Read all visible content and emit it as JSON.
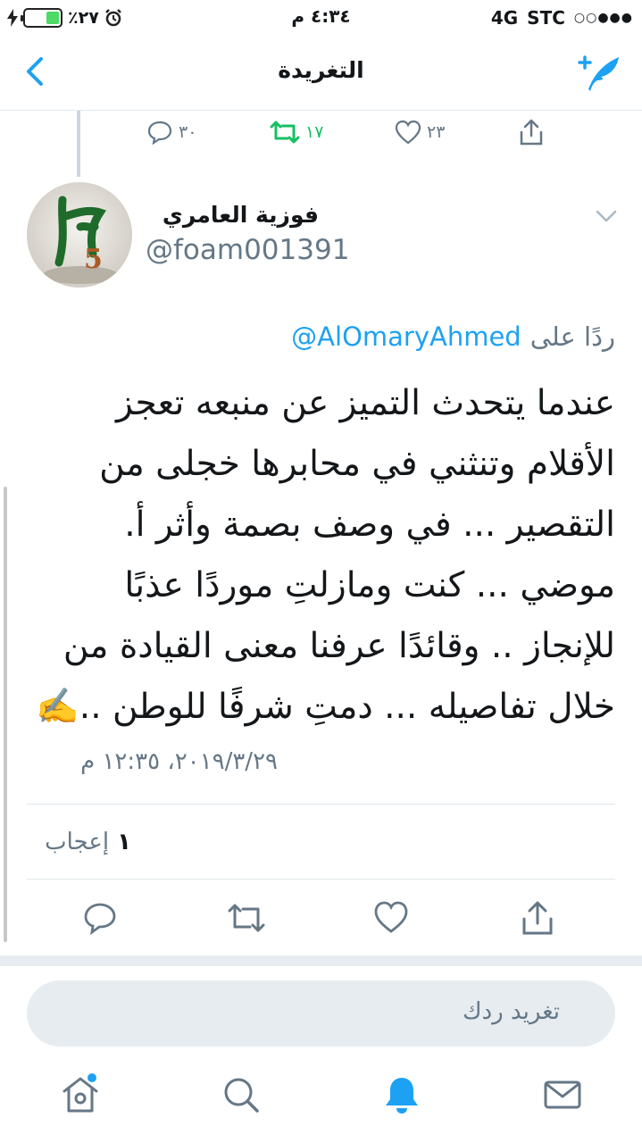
{
  "status_bar": {
    "battery_percent": "٪٢٧",
    "time": "٤:٣٤ م",
    "network": "4G",
    "carrier": "STC",
    "signal": "○○●●●"
  },
  "nav": {
    "title": "التغريدة"
  },
  "prev_tweet_actions": {
    "replies": "٣٠",
    "retweets": "١٧",
    "likes": "٢٣"
  },
  "tweet": {
    "author_name": "فوزية العامري",
    "author_handle": "@foam001391",
    "reply_prefix": "ردًا على",
    "reply_mention": "@AlOmaryAhmed",
    "lines": [
      "عندما يتحدث التميز عن منبعه تعجز",
      "الأقلام وتنثني في محابرها خجلى من",
      "التقصير ... في وصف بصمة وأثر أ.",
      "موضي ... كنت ومازلتِ موردًا عذبًا",
      "للإنجاز .. وقائدًا عرفنا معنى القيادة من",
      "خلال تفاصيله ... دمتِ شرفًا للوطن ..✍️"
    ],
    "timestamp": "٢٠١٩/٣/٢٩، ١٢:٣٥ م",
    "likes_count": "١",
    "likes_label": "إعجاب"
  },
  "reply_box": {
    "placeholder": "تغريد ردك"
  },
  "colors": {
    "accent": "#1da1f2",
    "retweet": "#17bf63",
    "muted": "#657786",
    "divider": "#e1e8ed"
  },
  "icons": {
    "back": "chevron-left-icon",
    "compose": "compose-tweet-icon",
    "reply": "reply-icon",
    "retweet": "retweet-icon",
    "like": "heart-icon",
    "share": "share-icon",
    "home": "home-icon",
    "search": "search-icon",
    "notifications": "bell-icon",
    "messages": "mail-icon"
  }
}
